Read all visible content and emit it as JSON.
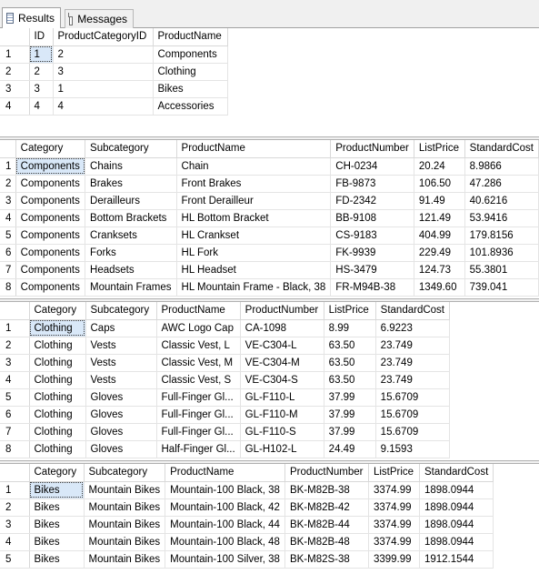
{
  "tabs": [
    {
      "label": "Results",
      "icon": "results-grid-icon",
      "active": true
    },
    {
      "label": "Messages",
      "icon": "messages-page-icon",
      "active": false
    }
  ],
  "grids": [
    {
      "name": "result-grid-1",
      "columns": [
        "ID",
        "ProductCategoryID",
        "ProductName"
      ],
      "rows": [
        [
          "1",
          "2",
          "Components"
        ],
        [
          "2",
          "3",
          "Clothing"
        ],
        [
          "3",
          "1",
          "Bikes"
        ],
        [
          "4",
          "4",
          "Accessories"
        ]
      ]
    },
    {
      "name": "result-grid-2",
      "columns": [
        "Category",
        "Subcategory",
        "ProductName",
        "ProductNumber",
        "ListPrice",
        "StandardCost"
      ],
      "rows": [
        [
          "Components",
          "Chains",
          "Chain",
          "CH-0234",
          "20.24",
          "8.9866"
        ],
        [
          "Components",
          "Brakes",
          "Front Brakes",
          "FB-9873",
          "106.50",
          "47.286"
        ],
        [
          "Components",
          "Derailleurs",
          "Front Derailleur",
          "FD-2342",
          "91.49",
          "40.6216"
        ],
        [
          "Components",
          "Bottom Brackets",
          "HL Bottom Bracket",
          "BB-9108",
          "121.49",
          "53.9416"
        ],
        [
          "Components",
          "Cranksets",
          "HL Crankset",
          "CS-9183",
          "404.99",
          "179.8156"
        ],
        [
          "Components",
          "Forks",
          "HL Fork",
          "FK-9939",
          "229.49",
          "101.8936"
        ],
        [
          "Components",
          "Headsets",
          "HL Headset",
          "HS-3479",
          "124.73",
          "55.3801"
        ],
        [
          "Components",
          "Mountain Frames",
          "HL Mountain Frame - Black, 38",
          "FR-M94B-38",
          "1349.60",
          "739.041"
        ]
      ]
    },
    {
      "name": "result-grid-3",
      "columns": [
        "Category",
        "Subcategory",
        "ProductName",
        "ProductNumber",
        "ListPrice",
        "StandardCost"
      ],
      "rows": [
        [
          "Clothing",
          "Caps",
          "AWC Logo Cap",
          "CA-1098",
          "8.99",
          "6.9223"
        ],
        [
          "Clothing",
          "Vests",
          "Classic Vest, L",
          "VE-C304-L",
          "63.50",
          "23.749"
        ],
        [
          "Clothing",
          "Vests",
          "Classic Vest, M",
          "VE-C304-M",
          "63.50",
          "23.749"
        ],
        [
          "Clothing",
          "Vests",
          "Classic Vest, S",
          "VE-C304-S",
          "63.50",
          "23.749"
        ],
        [
          "Clothing",
          "Gloves",
          "Full-Finger Gl...",
          "GL-F110-L",
          "37.99",
          "15.6709"
        ],
        [
          "Clothing",
          "Gloves",
          "Full-Finger Gl...",
          "GL-F110-M",
          "37.99",
          "15.6709"
        ],
        [
          "Clothing",
          "Gloves",
          "Full-Finger Gl...",
          "GL-F110-S",
          "37.99",
          "15.6709"
        ],
        [
          "Clothing",
          "Gloves",
          "Half-Finger Gl...",
          "GL-H102-L",
          "24.49",
          "9.1593"
        ]
      ]
    },
    {
      "name": "result-grid-4",
      "columns": [
        "Category",
        "Subcategory",
        "ProductName",
        "ProductNumber",
        "ListPrice",
        "StandardCost"
      ],
      "rows": [
        [
          "Bikes",
          "Mountain Bikes",
          "Mountain-100 Black, 38",
          "BK-M82B-38",
          "3374.99",
          "1898.0944"
        ],
        [
          "Bikes",
          "Mountain Bikes",
          "Mountain-100 Black, 42",
          "BK-M82B-42",
          "3374.99",
          "1898.0944"
        ],
        [
          "Bikes",
          "Mountain Bikes",
          "Mountain-100 Black, 44",
          "BK-M82B-44",
          "3374.99",
          "1898.0944"
        ],
        [
          "Bikes",
          "Mountain Bikes",
          "Mountain-100 Black, 48",
          "BK-M82B-48",
          "3374.99",
          "1898.0944"
        ],
        [
          "Bikes",
          "Mountain Bikes",
          "Mountain-100 Silver, 38",
          "BK-M82S-38",
          "3399.99",
          "1912.1544"
        ]
      ]
    }
  ]
}
